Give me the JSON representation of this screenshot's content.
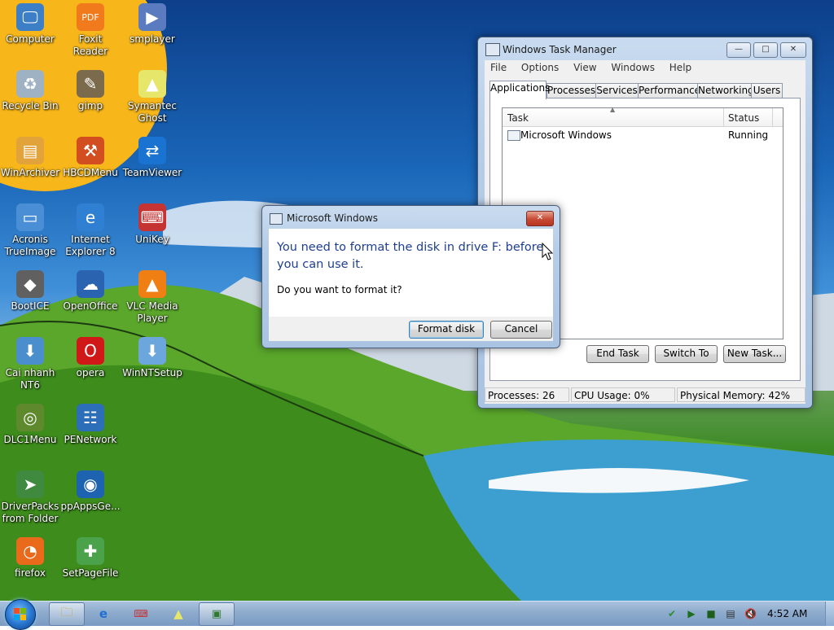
{
  "desktop": {
    "icons": [
      {
        "label": "Computer",
        "icon": "computer-icon",
        "color": "#3d7fc6"
      },
      {
        "label": "Foxit Reader",
        "icon": "pdf-icon",
        "color": "#f07a1c"
      },
      {
        "label": "smplayer",
        "icon": "player-icon",
        "color": "#5a7bbf"
      },
      {
        "label": "Recycle Bin",
        "icon": "recycle-bin-icon",
        "color": "#9fb2c4"
      },
      {
        "label": "gimp",
        "icon": "gimp-icon",
        "color": "#7b6a4c"
      },
      {
        "label": "Symantec Ghost",
        "icon": "ghost-icon",
        "color": "#e6e66a"
      },
      {
        "label": "WinArchiver",
        "icon": "archive-icon",
        "color": "#e2a33b"
      },
      {
        "label": "HBCDMenu",
        "icon": "tools-icon",
        "color": "#d24d20"
      },
      {
        "label": "TeamViewer",
        "icon": "teamviewer-icon",
        "color": "#1b73d1"
      },
      {
        "label": "Acronis TrueImage",
        "icon": "monitor-icon",
        "color": "#4a8fd6"
      },
      {
        "label": "Internet Explorer 8",
        "icon": "ie-icon",
        "color": "#2f7fd3"
      },
      {
        "label": "UniKey",
        "icon": "keyboard-icon",
        "color": "#c63333"
      },
      {
        "label": "BootICE",
        "icon": "diamond-icon",
        "color": "#606060"
      },
      {
        "label": "OpenOffice",
        "icon": "openoffice-icon",
        "color": "#2a64b0"
      },
      {
        "label": "VLC Media Player",
        "icon": "vlc-cone-icon",
        "color": "#ef7f12"
      },
      {
        "label": "Cai nhanh NT6",
        "icon": "setup-icon",
        "color": "#4a8ecd"
      },
      {
        "label": "opera",
        "icon": "opera-icon",
        "color": "#d01818"
      },
      {
        "label": "WinNTSetup",
        "icon": "setup-icon",
        "color": "#6ba6dc"
      },
      {
        "label": "DLC1Menu",
        "icon": "disc-icon",
        "color": "#5e8a2d"
      },
      {
        "label": "PENetwork",
        "icon": "network-icon",
        "color": "#2c6fb8"
      },
      {
        "label": "DriverPacks from Folder",
        "icon": "driver-icon",
        "color": "#3f8a3f"
      },
      {
        "label": "ppAppsGe...",
        "icon": "globe-icon",
        "color": "#1e63b0"
      },
      {
        "label": "firefox",
        "icon": "firefox-icon",
        "color": "#e86a1a"
      },
      {
        "label": "SetPageFile",
        "icon": "pagefile-icon",
        "color": "#4aa34a"
      }
    ]
  },
  "taskmgr": {
    "title": "Windows Task Manager",
    "menu": [
      "File",
      "Options",
      "View",
      "Windows",
      "Help"
    ],
    "tabs": [
      "Applications",
      "Processes",
      "Services",
      "Performance",
      "Networking",
      "Users"
    ],
    "columns": {
      "task": "Task",
      "status": "Status"
    },
    "rows": [
      {
        "task": "Microsoft Windows",
        "status": "Running"
      }
    ],
    "buttons": {
      "end_task": "End Task",
      "switch_to": "Switch To",
      "new_task": "New Task..."
    },
    "status": {
      "processes": "Processes: 26",
      "cpu": "CPU Usage: 0%",
      "memory": "Physical Memory: 42%"
    }
  },
  "dialog": {
    "title": "Microsoft Windows",
    "message": "You need to format the disk in drive F: before you can use it.",
    "question": "Do you want to format it?",
    "buttons": {
      "format": "Format disk",
      "cancel": "Cancel"
    }
  },
  "taskbar": {
    "clock": "4:52 AM"
  }
}
